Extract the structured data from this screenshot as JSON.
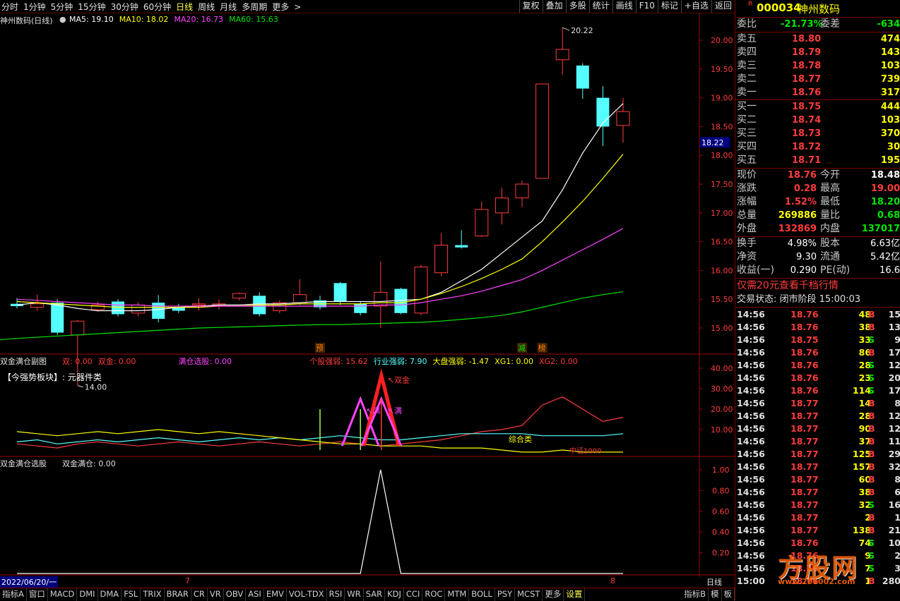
{
  "toolbar": {
    "periods": [
      "分时",
      "1分钟",
      "5分钟",
      "15分钟",
      "30分钟",
      "60分钟",
      "日线",
      "周线",
      "月线",
      "多周期",
      "更多"
    ],
    "active_period": "日线",
    "more_arrow": ">",
    "buttons": [
      "复权",
      "叠加",
      "多股",
      "统计",
      "画线",
      "F10",
      "标记",
      "+自选",
      "返回"
    ]
  },
  "main_chart": {
    "title": "神州数码(日线)",
    "ma_labels": [
      {
        "text": "MA5: 19.10",
        "color": "#ffffff"
      },
      {
        "text": "MA10: 18.02",
        "color": "#ffff00"
      },
      {
        "text": "MA20: 16.73",
        "color": "#ff44ff"
      },
      {
        "text": "MA60: 15.63",
        "color": "#00e600"
      }
    ],
    "high_label": "20.22",
    "low_label": "14.00",
    "current_price_tag": "18.22",
    "price_ticks": [
      "20.00",
      "19.50",
      "19.00",
      "18.50",
      "18.00",
      "17.50",
      "17.00",
      "16.50",
      "16.00",
      "15.50",
      "15.00"
    ],
    "markers": [
      "预",
      "减",
      "榜"
    ],
    "candles": [
      [
        15.42,
        15.38,
        15.52,
        15.34
      ],
      [
        15.36,
        15.42,
        15.58,
        15.3
      ],
      [
        15.44,
        14.92,
        15.5,
        14.88
      ],
      [
        14.88,
        15.12,
        15.14,
        14.0
      ],
      [
        15.32,
        15.4,
        15.46,
        15.28
      ],
      [
        15.46,
        15.24,
        15.5,
        15.2
      ],
      [
        15.26,
        15.4,
        15.45,
        15.2
      ],
      [
        15.44,
        15.16,
        15.57,
        15.1
      ],
      [
        15.36,
        15.3,
        15.42,
        15.26
      ],
      [
        15.4,
        15.42,
        15.52,
        15.3
      ],
      [
        15.42,
        15.42,
        15.5,
        15.32
      ],
      [
        15.52,
        15.6,
        15.62,
        15.48
      ],
      [
        15.56,
        15.24,
        15.62,
        15.2
      ],
      [
        15.3,
        15.44,
        15.48,
        15.26
      ],
      [
        15.44,
        15.58,
        15.85,
        15.4
      ],
      [
        15.48,
        15.36,
        15.56,
        15.32
      ],
      [
        15.78,
        15.46,
        15.8,
        15.4
      ],
      [
        15.42,
        15.26,
        15.46,
        15.22
      ],
      [
        15.38,
        15.62,
        16.16,
        15.0
      ],
      [
        15.68,
        15.26,
        15.7,
        15.24
      ],
      [
        15.26,
        16.06,
        16.1,
        15.22
      ],
      [
        15.96,
        16.44,
        16.65,
        15.9
      ],
      [
        16.44,
        16.4,
        16.7,
        16.38
      ],
      [
        16.6,
        17.06,
        17.2,
        16.58
      ],
      [
        17.0,
        17.26,
        17.44,
        16.8
      ],
      [
        17.26,
        17.5,
        17.56,
        17.1
      ],
      [
        17.6,
        19.24,
        19.24,
        17.6
      ],
      [
        19.66,
        19.84,
        20.22,
        19.4
      ],
      [
        19.56,
        19.16,
        19.6,
        18.98
      ],
      [
        19.0,
        18.5,
        19.2,
        18.16
      ],
      [
        18.52,
        18.76,
        19.0,
        18.22
      ]
    ],
    "ma5": [
      15.44,
      15.4,
      15.34,
      15.3,
      15.3,
      15.3,
      15.32,
      15.36,
      15.38,
      15.4,
      15.4,
      15.42,
      15.42,
      15.44,
      15.46,
      15.46,
      15.46,
      15.46,
      15.48,
      15.5,
      15.62,
      15.82,
      16.02,
      16.3,
      16.58,
      16.86,
      17.4,
      18.04,
      18.56,
      18.9,
      19.1
    ],
    "ma10": [
      15.46,
      15.44,
      15.42,
      15.4,
      15.38,
      15.36,
      15.36,
      15.36,
      15.36,
      15.36,
      15.38,
      15.38,
      15.4,
      15.4,
      15.42,
      15.42,
      15.42,
      15.42,
      15.44,
      15.44,
      15.5,
      15.6,
      15.72,
      15.86,
      16.02,
      16.2,
      16.5,
      16.84,
      17.2,
      17.6,
      18.02
    ],
    "ma20": [
      15.5,
      15.48,
      15.46,
      15.44,
      15.42,
      15.4,
      15.4,
      15.38,
      15.38,
      15.38,
      15.38,
      15.38,
      15.38,
      15.38,
      15.38,
      15.38,
      15.38,
      15.38,
      15.4,
      15.4,
      15.44,
      15.5,
      15.56,
      15.64,
      15.74,
      15.84,
      16.0,
      16.18,
      16.36,
      16.54,
      16.73
    ],
    "ma60": [
      14.82,
      14.84,
      14.86,
      14.88,
      14.9,
      14.92,
      14.94,
      14.96,
      14.98,
      15.0,
      15.01,
      15.02,
      15.03,
      15.04,
      15.05,
      15.06,
      15.06,
      15.07,
      15.08,
      15.09,
      15.1,
      15.12,
      15.15,
      15.18,
      15.22,
      15.28,
      15.36,
      15.44,
      15.52,
      15.58,
      15.63
    ]
  },
  "sub1": {
    "title": "双金满仓副图",
    "labels": [
      {
        "text": "双: 0.00",
        "color": "#ff3c3c"
      },
      {
        "text": "双金: 0.00",
        "color": "#ff3c3c"
      },
      {
        "text": "满仓选股: 0.00",
        "color": "#ff44ff"
      },
      {
        "text": "个股强弱: 15.62",
        "color": "#ff3c3c"
      },
      {
        "text": "行业强弱: 7.90",
        "color": "#54ffff"
      },
      {
        "text": "大盘强弱: -1.47",
        "color": "#ffff00"
      },
      {
        "text": "XG1: 0.00",
        "color": "#ffff00"
      },
      {
        "text": "XG2: 0.00",
        "color": "#ff3c3c"
      }
    ],
    "sector_text": "【今强势板块】: 元器件类",
    "ticks": [
      "40.00",
      "30.00",
      "20.00",
      "10.00"
    ],
    "annotations": [
      "双金",
      "满",
      "满",
      "综合类",
      "中证1000"
    ],
    "stock_strength": [
      3,
      2,
      1,
      3,
      4,
      3,
      2,
      3,
      4,
      3,
      2,
      3,
      4,
      3,
      2,
      3,
      4,
      3,
      2,
      3,
      4,
      5,
      7,
      9,
      10,
      12,
      22,
      26,
      20,
      14,
      16
    ],
    "industry_strength": [
      4,
      5,
      3,
      4,
      5,
      4,
      5,
      6,
      5,
      4,
      5,
      6,
      5,
      6,
      5,
      6,
      7,
      6,
      5,
      5,
      6,
      7,
      8,
      8,
      8,
      8,
      7,
      7,
      7,
      7,
      8
    ],
    "market_strength": [
      9,
      8,
      7,
      8,
      9,
      8,
      9,
      10,
      9,
      8,
      9,
      8,
      7,
      6,
      5,
      4,
      3,
      3,
      2,
      2,
      2,
      1,
      1,
      1,
      0,
      -1,
      -1,
      0,
      -1,
      -1,
      -1
    ]
  },
  "sub2": {
    "title": "双金满仓选股",
    "value_label": "双金满仓: 0.00",
    "ticks": [
      "1.00",
      "0.80",
      "0.60",
      "0.40",
      "0.20"
    ],
    "values": [
      0,
      0,
      0,
      0,
      0,
      0,
      0,
      0,
      0,
      0,
      0,
      0,
      0,
      0,
      0,
      0,
      0,
      0,
      0,
      0,
      0,
      1,
      0,
      0,
      0,
      0,
      0,
      0,
      0,
      0,
      0
    ]
  },
  "date_axis": {
    "start": "2022/06/20/一",
    "m7": "7",
    "m8": "8",
    "period": "日线"
  },
  "bottom_tabs": [
    "指标A",
    "窗口",
    "MACD",
    "DMI",
    "DMA",
    "FSL",
    "TRIX",
    "BRAR",
    "CR",
    "VR",
    "OBV",
    "ASI",
    "EMV",
    "VOL-TDX",
    "RSI",
    "WR",
    "SAR",
    "KDJ",
    "CCI",
    "ROC",
    "MTM",
    "BOLL",
    "PSY",
    "MCST",
    "更多",
    "设置"
  ],
  "bottom_right": [
    "指标B",
    "模",
    "板"
  ],
  "quote": {
    "code_badge": "R",
    "code": "000034",
    "name": "神州数码",
    "weibi": {
      "label": "委比",
      "value": "-21.73%",
      "label2": "委差",
      "value2": "-634"
    },
    "asks": [
      {
        "label": "卖五",
        "price": "18.80",
        "vol": "474"
      },
      {
        "label": "卖四",
        "price": "18.79",
        "vol": "143"
      },
      {
        "label": "卖三",
        "price": "18.78",
        "vol": "103"
      },
      {
        "label": "卖二",
        "price": "18.77",
        "vol": "739"
      },
      {
        "label": "卖一",
        "price": "18.76",
        "vol": "317"
      }
    ],
    "bids": [
      {
        "label": "买一",
        "price": "18.75",
        "vol": "444"
      },
      {
        "label": "买二",
        "price": "18.74",
        "vol": "103"
      },
      {
        "label": "买三",
        "price": "18.73",
        "vol": "370"
      },
      {
        "label": "买四",
        "price": "18.72",
        "vol": "30"
      },
      {
        "label": "买五",
        "price": "18.71",
        "vol": "195"
      }
    ],
    "stats": [
      {
        "l1": "现价",
        "v1": "18.76",
        "c1": "red",
        "l2": "今开",
        "v2": "18.48",
        "c2": "wht"
      },
      {
        "l1": "涨跌",
        "v1": "0.28",
        "c1": "red",
        "l2": "最高",
        "v2": "19.00",
        "c2": "red"
      },
      {
        "l1": "涨幅",
        "v1": "1.52%",
        "c1": "red",
        "l2": "最低",
        "v2": "18.20",
        "c2": "grn"
      },
      {
        "l1": "总量",
        "v1": "269886",
        "c1": "yel",
        "l2": "量比",
        "v2": "0.68",
        "c2": "grn"
      },
      {
        "l1": "外盘",
        "v1": "132869",
        "c1": "red",
        "l2": "内盘",
        "v2": "137017",
        "c2": "grn"
      }
    ],
    "fund": [
      {
        "l1": "换手",
        "v1": "4.98%",
        "l2": "股本",
        "v2": "6.63亿"
      },
      {
        "l1": "净资",
        "v1": "9.30",
        "l2": "流通",
        "v2": "5.42亿"
      },
      {
        "l1": "收益(一)",
        "v1": "0.290",
        "l2": "PE(动)",
        "v2": "16.6"
      }
    ],
    "promo": "仅需20元查看千档行情",
    "trade_status": "交易状态: 闭市阶段 15:00:03",
    "ticks": [
      [
        "14:56",
        "18.76",
        "48",
        "B",
        "15"
      ],
      [
        "14:56",
        "18.76",
        "38",
        "B",
        "13"
      ],
      [
        "14:56",
        "18.75",
        "33",
        "S",
        "9"
      ],
      [
        "14:56",
        "18.76",
        "86",
        "B",
        "17"
      ],
      [
        "14:56",
        "18.76",
        "28",
        "S",
        "12"
      ],
      [
        "14:56",
        "18.76",
        "23",
        "S",
        "20"
      ],
      [
        "14:56",
        "18.76",
        "114",
        "S",
        "17"
      ],
      [
        "14:56",
        "18.77",
        "14",
        "B",
        "8"
      ],
      [
        "14:56",
        "18.77",
        "28",
        "B",
        "12"
      ],
      [
        "14:56",
        "18.77",
        "90",
        "B",
        "12"
      ],
      [
        "14:56",
        "18.77",
        "37",
        "B",
        "11"
      ],
      [
        "14:56",
        "18.77",
        "125",
        "B",
        "29"
      ],
      [
        "14:56",
        "18.77",
        "157",
        "B",
        "32"
      ],
      [
        "14:56",
        "18.77",
        "60",
        "B",
        "8"
      ],
      [
        "14:56",
        "18.77",
        "38",
        "B",
        "6"
      ],
      [
        "14:56",
        "18.77",
        "32",
        "S",
        "16"
      ],
      [
        "14:56",
        "18.77",
        "2",
        "B",
        "1"
      ],
      [
        "14:56",
        "18.77",
        "138",
        "B",
        "21"
      ],
      [
        "14:56",
        "18.76",
        "74",
        "S",
        "10"
      ],
      [
        "14:56",
        "18.76",
        "9",
        "S",
        "2"
      ],
      [
        "14:56",
        "18.76",
        "7",
        "S",
        "3"
      ],
      [
        "15:00",
        "18.76",
        "1",
        "B",
        "280"
      ]
    ],
    "watermark": "方股网",
    "watermark_url": "www.201002.com"
  }
}
